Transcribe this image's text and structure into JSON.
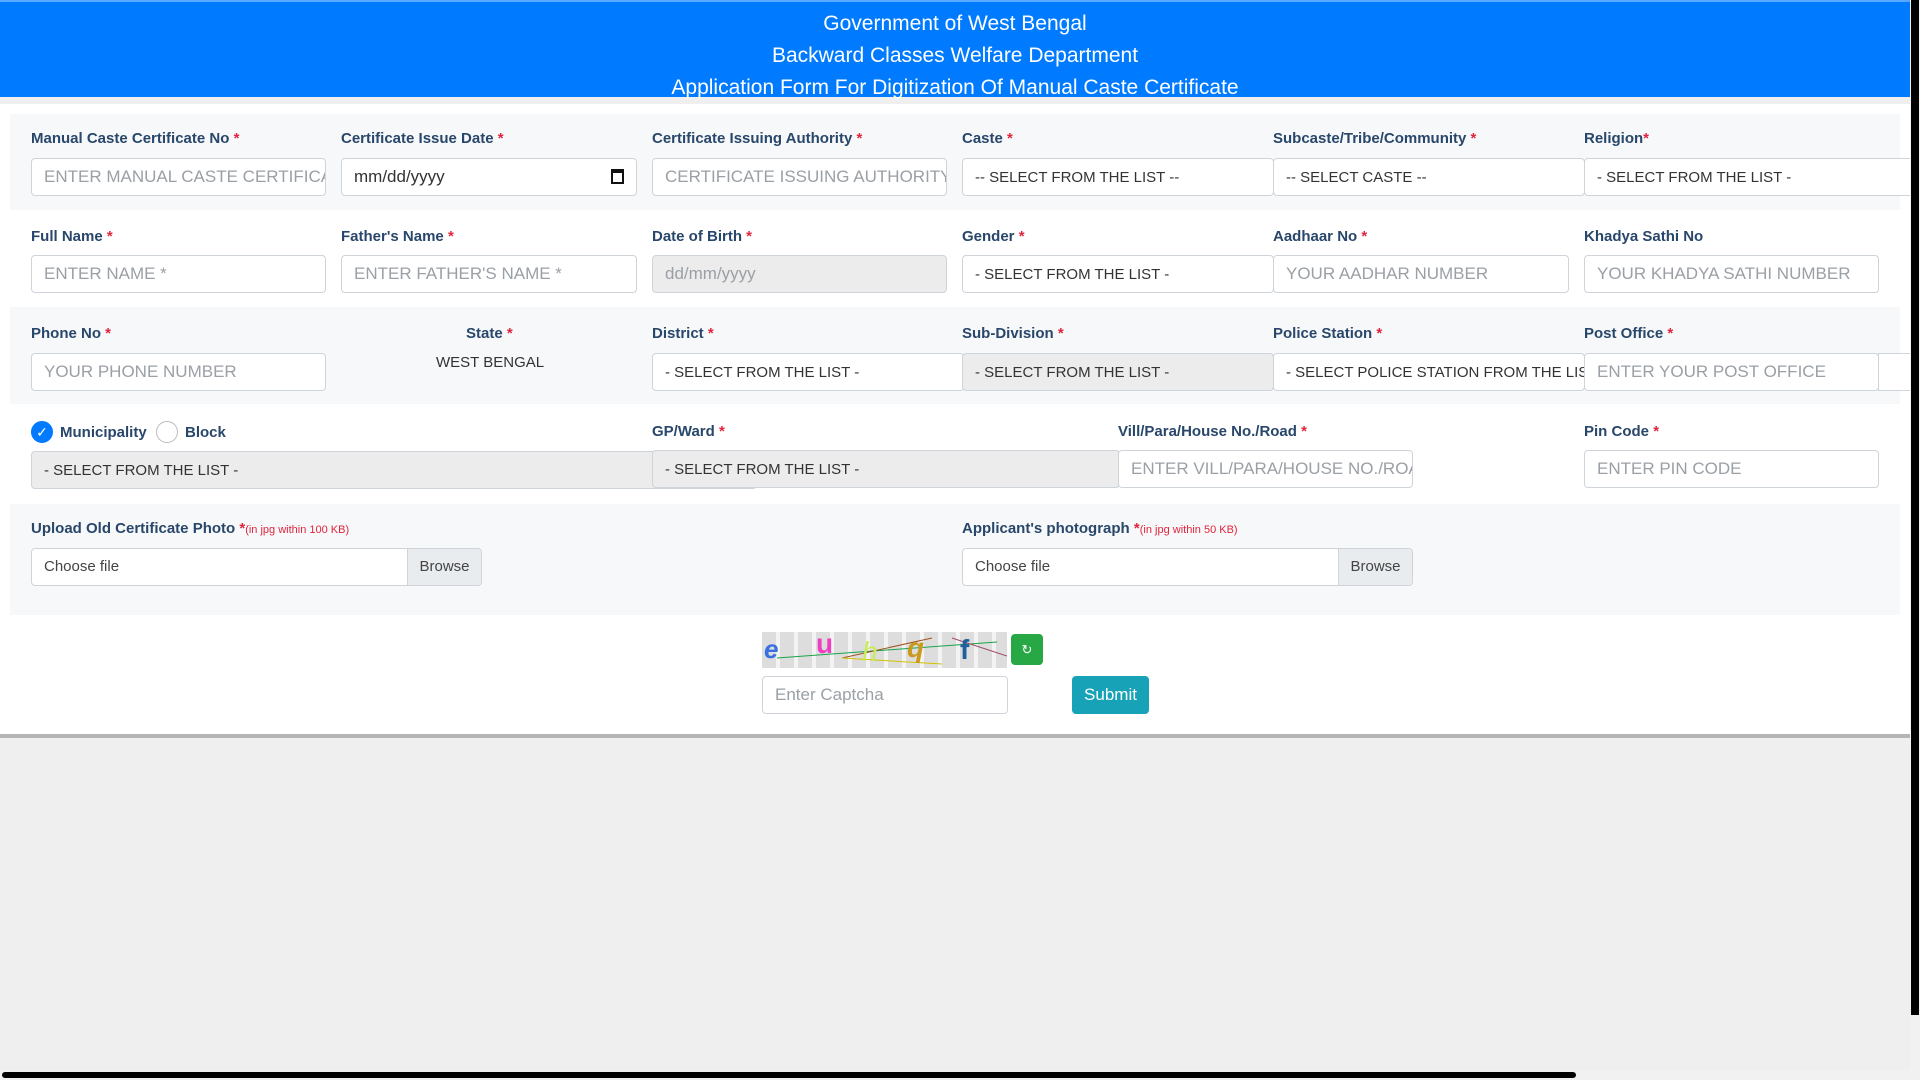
{
  "header": {
    "line1": "Government of West Bengal",
    "line2": "Backward Classes Welfare Department",
    "line3": "Application Form For Digitization Of Manual Caste Certificate"
  },
  "req": "*",
  "row1": {
    "cert_no": {
      "label": "Manual Caste Certificate No",
      "placeholder": "ENTER MANUAL CASTE CERTIFICATE NO"
    },
    "issue_date": {
      "label": "Certificate Issue Date",
      "value": "mm/dd/yyyy"
    },
    "authority": {
      "label": "Certificate Issuing Authority",
      "placeholder": "CERTIFICATE ISSUING AUTHORITY"
    },
    "caste": {
      "label": "Caste",
      "value": "-- SELECT FROM THE LIST --"
    },
    "subcaste": {
      "label": "Subcaste/Tribe/Community",
      "value": "-- SELECT CASTE --"
    },
    "religion": {
      "label": "Religion",
      "value": "- SELECT FROM THE LIST -"
    }
  },
  "row2": {
    "name": {
      "label": "Full Name",
      "placeholder": "ENTER NAME *"
    },
    "father": {
      "label": "Father's Name",
      "placeholder": "ENTER FATHER'S NAME *"
    },
    "dob": {
      "label": "Date of Birth",
      "placeholder": "dd/mm/yyyy"
    },
    "gender": {
      "label": "Gender",
      "value": "- SELECT FROM THE LIST -"
    },
    "aadhaar": {
      "label": "Aadhaar No",
      "placeholder": "YOUR AADHAR NUMBER"
    },
    "khadya": {
      "label": "Khadya Sathi No",
      "placeholder": "YOUR KHADYA SATHI NUMBER"
    }
  },
  "row3": {
    "phone": {
      "label": "Phone No",
      "placeholder": "YOUR PHONE NUMBER"
    },
    "state": {
      "label": "State",
      "value": "WEST BENGAL"
    },
    "district": {
      "label": "District",
      "value": "- SELECT FROM THE LIST -"
    },
    "subdivision": {
      "label": "Sub-Division",
      "value": "- SELECT FROM THE LIST -"
    },
    "police": {
      "label": "Police Station",
      "value": "- SELECT POLICE STATION FROM THE LIST -"
    },
    "post": {
      "label": "Post Office",
      "placeholder": "ENTER YOUR POST OFFICE"
    }
  },
  "row4": {
    "municipality": "Municipality",
    "block": "Block",
    "area_select": "- SELECT FROM THE LIST -",
    "gp": {
      "label": "GP/Ward",
      "value": "- SELECT FROM THE LIST -"
    },
    "vill": {
      "label": "Vill/Para/House No./Road",
      "placeholder": "ENTER VILL/PARA/HOUSE NO./ROAD"
    },
    "pin": {
      "label": "Pin Code",
      "placeholder": "ENTER PIN CODE"
    }
  },
  "row5": {
    "old_cert": {
      "label": "Upload Old Certificate Photo",
      "note": "(in jpg within 100 KB)",
      "file": "Choose file",
      "browse": "Browse"
    },
    "photo": {
      "label": "Applicant's photograph",
      "note": "(in jpg within 50 KB)",
      "file": "Choose file",
      "browse": "Browse"
    }
  },
  "captcha": {
    "chars": [
      "e",
      "u",
      "h",
      "q",
      "f"
    ],
    "placeholder": "Enter Captcha",
    "refresh_icon": "refresh-icon",
    "submit": "Submit"
  },
  "colors": {
    "primary": "#007bff",
    "submit": "#17a2b8",
    "refresh": "#28a745"
  }
}
